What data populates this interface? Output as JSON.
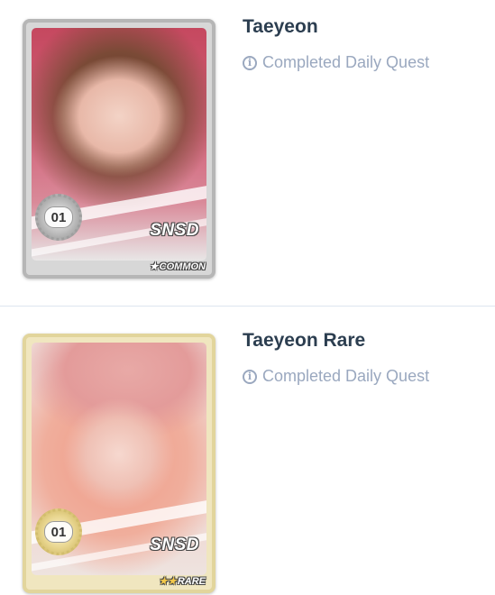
{
  "cards": [
    {
      "title": "Taeyeon",
      "requirement": "Completed Daily Quest",
      "card_number": "01",
      "group": "SNSD",
      "rarity_stars": "★",
      "rarity_label": "COMMON",
      "frame_color": "#b6b6b6"
    },
    {
      "title": "Taeyeon Rare",
      "requirement": "Completed Daily Quest",
      "card_number": "01",
      "group": "SNSD",
      "rarity_stars": "★★",
      "rarity_label": "RARE",
      "frame_color": "#e2d59c"
    }
  ],
  "icons": {
    "requirement_icon": "info-circle-icon"
  },
  "colors": {
    "title": "#2c3e50",
    "muted": "#9aa8bf",
    "divider": "#dde6ef"
  }
}
